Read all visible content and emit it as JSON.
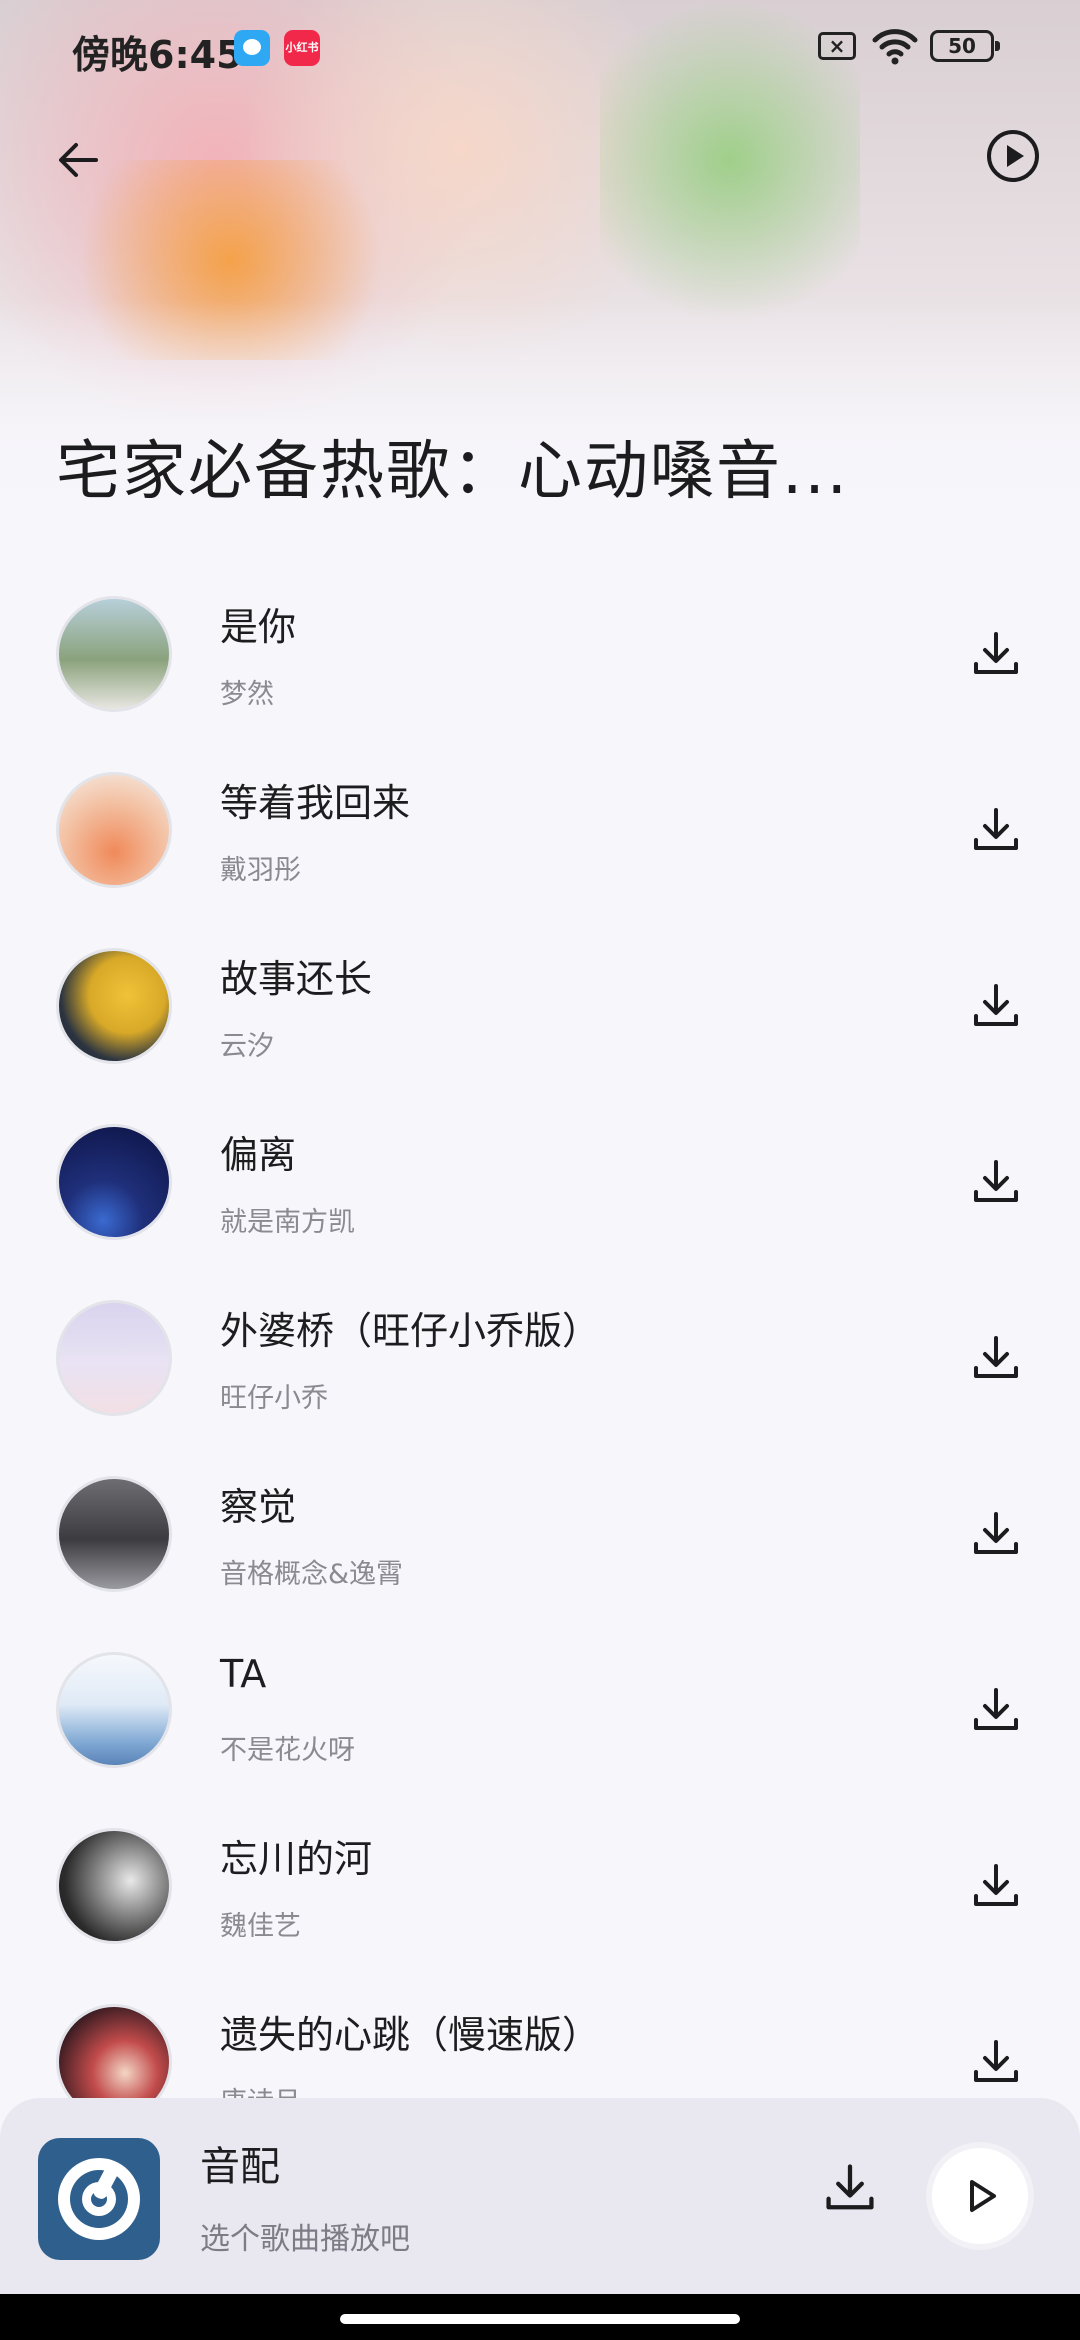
{
  "status_bar": {
    "time": "傍晚6:45",
    "notif_app2": "小红书",
    "battery": "50"
  },
  "playlist": {
    "title": "宅家必备热歌：心动嗓音..."
  },
  "songs": [
    {
      "title": "是你",
      "artist": "梦然"
    },
    {
      "title": "等着我回来",
      "artist": "戴羽彤"
    },
    {
      "title": "故事还长",
      "artist": "云汐"
    },
    {
      "title": "偏离",
      "artist": "就是南方凯"
    },
    {
      "title": "外婆桥（旺仔小乔版）",
      "artist": "旺仔小乔"
    },
    {
      "title": "察觉",
      "artist": "音格概念&逸霄"
    },
    {
      "title": "TA",
      "artist": "不是花火呀"
    },
    {
      "title": "忘川的河",
      "artist": "魏佳艺"
    },
    {
      "title": "遗失的心跳（慢速版）",
      "artist": "唐诗吕"
    }
  ],
  "player": {
    "app_name": "音配",
    "hint": "选个歌曲播放吧"
  },
  "icons": {
    "back": "back-arrow-icon",
    "play": "play-icon",
    "download": "download-icon"
  }
}
